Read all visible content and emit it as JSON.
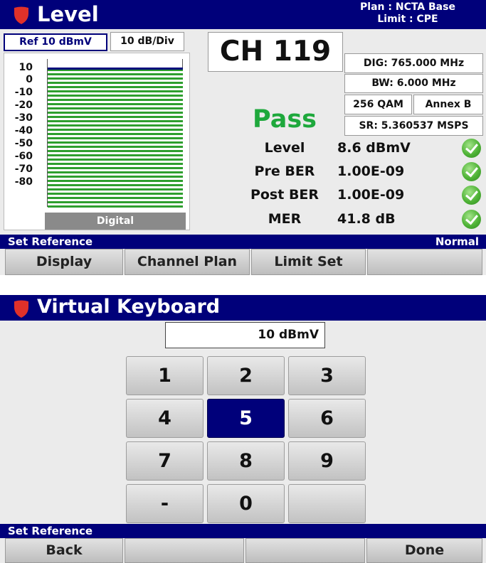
{
  "level_screen": {
    "title": "Level",
    "plan": "Plan : NCTA Base",
    "limit": "Limit : CPE",
    "ref_tab": "Ref 10 dBmV",
    "div_tab": "10 dB/Div",
    "y_ticks": [
      "10",
      "0",
      "-10",
      "-20",
      "-30",
      "-40",
      "-50",
      "-60",
      "-70",
      "-80"
    ],
    "meter_label": "Digital",
    "channel": "CH 119",
    "dig_freq": "DIG: 765.000 MHz",
    "bandwidth": "BW: 6.000 MHz",
    "modulation": "256 QAM",
    "annex": "Annex B",
    "symbol_rate": "SR: 5.360537 MSPS",
    "result": "Pass",
    "measurements": [
      {
        "label": "Level",
        "value": "8.6 dBmV"
      },
      {
        "label": "Pre BER",
        "value": "1.00E-09"
      },
      {
        "label": "Post BER",
        "value": "1.00E-09"
      },
      {
        "label": "MER",
        "value": "41.8 dB"
      }
    ],
    "status_left": "Set Reference",
    "status_right": "Normal",
    "softkeys": [
      "Display",
      "Channel Plan",
      "Limit Set",
      ""
    ]
  },
  "keyboard_screen": {
    "title": "Virtual Keyboard",
    "input_value": "10 dBmV",
    "keys": [
      "1",
      "2",
      "3",
      "4",
      "5",
      "6",
      "7",
      "8",
      "9",
      "-",
      "0",
      ""
    ],
    "active_key": "5",
    "status_left": "Set Reference",
    "softkeys": [
      "Back",
      "",
      "",
      "Done"
    ]
  },
  "colors": {
    "title_bar": "#00007a",
    "pass": "#1ea83c",
    "bar_green": "#2e9f2e",
    "logo_red": "#e0312a"
  },
  "icons": {
    "logo": "shield-logo-icon",
    "check": "check-circle-icon"
  }
}
